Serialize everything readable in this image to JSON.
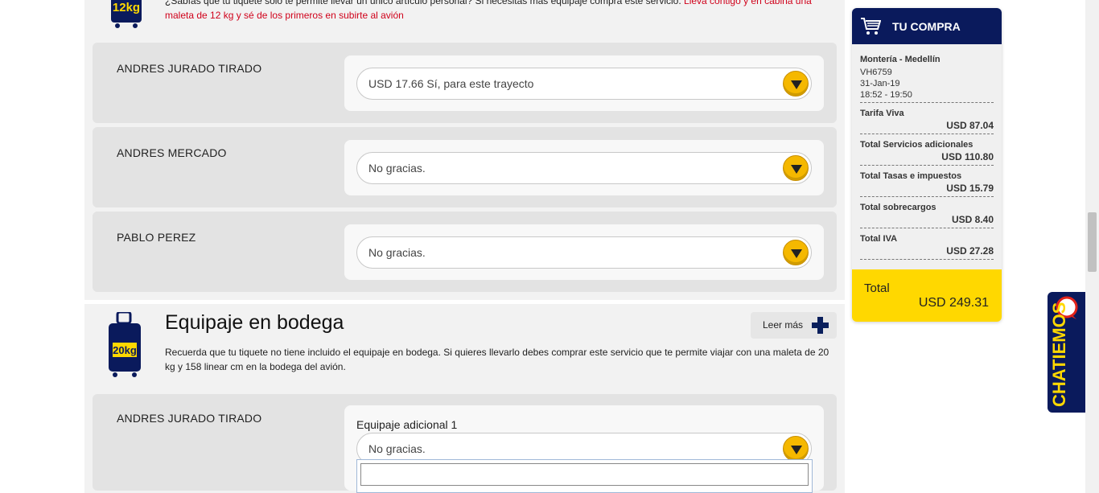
{
  "carry_on": {
    "bag_weight": "12kg",
    "info_text": "¿Sabías que tu tiquete solo te permite llevar un único artículo personal? Si necesitas más equipaje compra este servicio.",
    "info_highlight": "Lleva contigo y en cabina una maleta de 12 kg y sé de los primeros en subirte al avión",
    "passengers": [
      {
        "name": "ANDRES JURADO TIRADO",
        "selection": "USD 17.66 Sí, para este trayecto"
      },
      {
        "name": "ANDRES MERCADO",
        "selection": "No gracias."
      },
      {
        "name": "PABLO PEREZ",
        "selection": "No gracias."
      }
    ]
  },
  "checked": {
    "title": "Equipaje en bodega",
    "bag_weight": "20kg",
    "read_more_label": "Leer más",
    "info_text": "Recuerda que tu tiquete no tiene incluido el equipaje en bodega. Si quieres llevarlo debes comprar este servicio que te permite viajar con una maleta de 20 kg y 158 linear cm en la bodega del avión.",
    "passengers": [
      {
        "name": "ANDRES JURADO TIRADO",
        "field_label": "Equipaje adicional 1",
        "selection": "No gracias.",
        "search_value": ""
      }
    ]
  },
  "cart": {
    "title": "TU COMPRA",
    "route": "Montería - Medellín",
    "flight": "VH6759",
    "date": "31-Jan-19",
    "time": "18:52 - 19:50",
    "lines": [
      {
        "label": "Tarifa Viva",
        "amount": "USD 87.04"
      },
      {
        "label": "Total Servicios adicionales",
        "amount": "USD 110.80"
      },
      {
        "label": "Total Tasas e impuestos",
        "amount": "USD 15.79"
      },
      {
        "label": "Total sobrecargos",
        "amount": "USD 8.40"
      },
      {
        "label": "Total IVA",
        "amount": "USD 27.28"
      }
    ],
    "total_label": "Total",
    "total_amount": "USD 249.31"
  },
  "chat": {
    "label": "CHATIEMOS"
  },
  "colors": {
    "navy": "#0a1a5c",
    "yellow": "#ffd800",
    "red": "#d0021b",
    "accent_button": "#f5b800"
  }
}
